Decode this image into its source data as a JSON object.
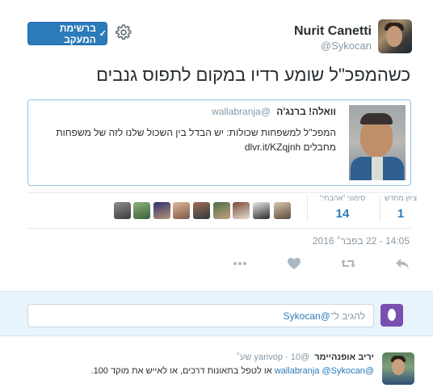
{
  "user": {
    "display_name": "Nurit Canetti",
    "screen_name": "@Sykocan"
  },
  "header": {
    "follow_button_label": "ברשימת המעקב",
    "settings_icon": "gear-icon",
    "follow_icon": "person-check-icon"
  },
  "tweet": {
    "text": "כשהמפכ\"ל שומע רדיו במקום לתפוס גנבים"
  },
  "quoted_tweet": {
    "name": "וואלה! ברנג'ה",
    "handle": "@wallabranja",
    "line1": "המפכ\"ל למשפחות שכולות: יש הבדל בין השכול שלנו לזה של משפחות",
    "line2": "מחבלים dlvr.it/KZqjnh"
  },
  "stats": {
    "retweets_label": "ציוץ מחדש",
    "retweets_value": "1",
    "likes_label": "סימוני \"אהבתי\"",
    "likes_value": "14",
    "liker_count": 9
  },
  "timestamp": "14:05 - 22 בפבר׳ 2016",
  "actions": {
    "reply_icon": "reply-icon",
    "retweet_icon": "retweet-icon",
    "like_icon": "heart-icon",
    "more_icon": "more-icon"
  },
  "reply_box": {
    "placeholder_prefix": "להגיב ל־",
    "placeholder_mention": "@Sykocan"
  },
  "reply_tweet": {
    "name": "יריב אופנהיימר",
    "handle": "@yarivop",
    "time": "· 10 שע׳",
    "mention1": "@wallabranja",
    "mention2": "@Sykocan",
    "text": "או לטפל בתאונות דרכים, או לאייש את מוקד 100."
  },
  "colors": {
    "accent": "#2b7bb9",
    "quote_border": "#8ec3eb",
    "reply_bar_bg": "#e8f4fb",
    "muted": "#8899a6"
  }
}
